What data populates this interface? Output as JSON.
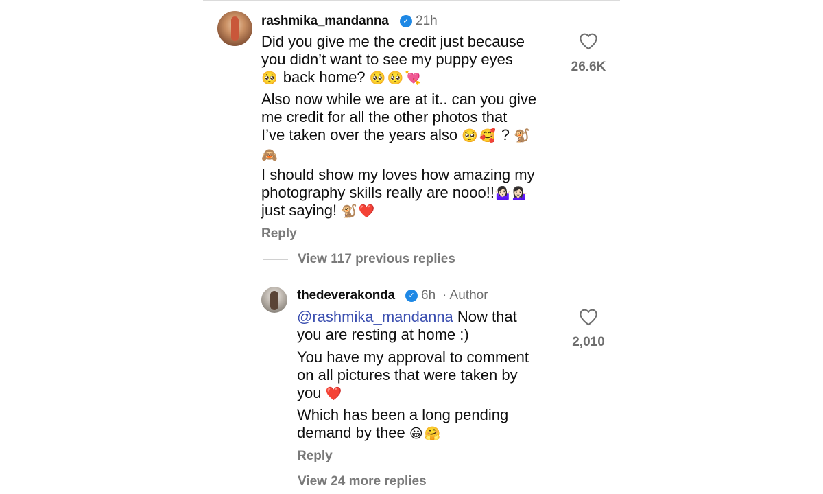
{
  "comment": {
    "username": "rashmika_mandanna",
    "time": "21h",
    "lines": [
      "Did you give me the credit just because",
      "you didn’t want to see my puppy eyes",
      "back home?",
      "Also now while we are at it.. can you give",
      "me credit for all the other photos that",
      "I’ve taken over the years also",
      "?",
      "I should show my loves how amazing my",
      "photography skills really are nooo!!",
      "just saying!"
    ],
    "emojis": {
      "line3_lead": "🥺",
      "line3_trail": "🥺🥺💘",
      "line6_trail": "🥺🥰",
      "line7_trail": "🐒",
      "line8_lead": "🙈",
      "line10_trail": "🤷🏻‍♀️💁🏻‍♀️",
      "line11_trail": "🐒❤️"
    },
    "reply_label": "Reply",
    "like_count": "26.6K"
  },
  "view_previous": "View 117 previous replies",
  "reply": {
    "username": "thedeverakonda",
    "time": "6h",
    "author_label": "· Author",
    "mention": "@rashmika_mandanna",
    "lines": [
      "Now that",
      "you are resting at home :)",
      "You have my approval to comment",
      "on all pictures that were taken by",
      "you",
      "Which has been a long pending",
      "demand by thee"
    ],
    "emojis": {
      "line5_trail": "❤️",
      "line7_trail": "😀🤗"
    },
    "reply_label": "Reply",
    "like_count": "2,010"
  },
  "view_more": "View 24 more replies",
  "icons": {
    "verified": "verified-badge-icon",
    "like": "heart-outline-icon"
  },
  "colors": {
    "verified": "#1e88e5",
    "mention": "#3b4fb0",
    "muted": "#7a7a7a"
  }
}
